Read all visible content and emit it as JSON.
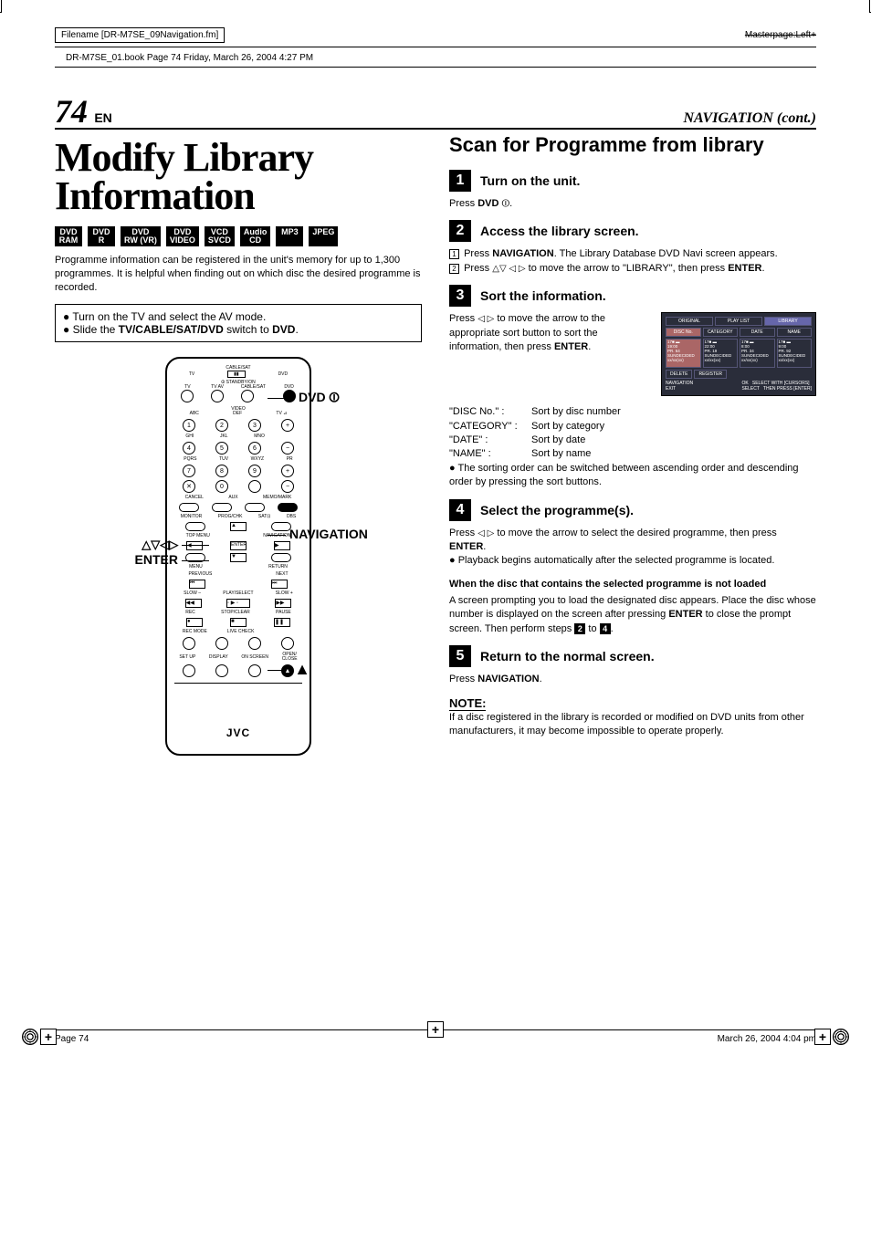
{
  "header": {
    "filename": "Filename [DR-M7SE_09Navigation.fm]",
    "masterpage": "Masterpage:Left+",
    "book_line": "DR-M7SE_01.book  Page 74  Friday, March 26, 2004  4:27 PM"
  },
  "page_header": {
    "page_number": "74",
    "lang": "EN",
    "section": "NAVIGATION (cont.)"
  },
  "left": {
    "title": "Modify Library Information",
    "badges": [
      {
        "l1": "DVD",
        "l2": "RAM"
      },
      {
        "l1": "DVD",
        "l2": "R"
      },
      {
        "l1": "DVD",
        "l2": "RW (VR)"
      },
      {
        "l1": "DVD",
        "l2": "VIDEO"
      },
      {
        "l1": "VCD",
        "l2": "SVCD"
      },
      {
        "l1": "Audio",
        "l2": "CD"
      },
      {
        "l1": "MP3",
        "l2": ""
      },
      {
        "l1": "JPEG",
        "l2": ""
      }
    ],
    "intro": "Programme information can be registered in the unit's memory for up to 1,300 programmes. It is helpful when finding out on which disc the desired programme is recorded.",
    "prep": [
      "Turn on the TV and select the AV mode.",
      "Slide the TV/CABLE/SAT/DVD switch to DVD."
    ],
    "prep_bold": [
      "TV/CABLE/SAT/DVD",
      "DVD"
    ],
    "remote_labels": {
      "dvd_power": "DVD ⏼",
      "navigation": "NAVIGATION",
      "cursors": "△▽◁▷",
      "enter": "ENTER",
      "eject": "▲"
    },
    "remote_text": {
      "cable_sat": "CABLE/SAT",
      "tv": "TV",
      "dvd": "DVD",
      "standby": "⏼ STANDBY/ON",
      "tvmute": "TV",
      "tvav": "TV AV",
      "cablesat": "CABLE/SAT",
      "dvd2": "DVD",
      "video": "VIDEO",
      "abc": "ABC",
      "def": "DEF",
      "tvvol": "TV ⊿",
      "ghi": "GHI",
      "jkl": "JKL",
      "mno": "MNO",
      "pqrs": "PQRS",
      "tuv": "TUV",
      "wxyz": "WXYZ",
      "pr": "PR",
      "cancel": "CANCEL",
      "aux": "AUX",
      "memomark": "MEMO/MARK",
      "monitor": "MONITOR",
      "progchk": "PROG/CHK",
      "satc": "SAT⊡",
      "dbs": "DBS",
      "topmenu": "TOP MENU",
      "navigation": "NAVIGATION",
      "menu": "MENU",
      "enter": "ENTER",
      "return": "RETURN",
      "previous": "PREVIOUS",
      "next": "NEXT",
      "slowm": "SLOW –",
      "playselect": "PLAY/SELECT",
      "slowp": "SLOW +",
      "rec": "REC",
      "stopclear": "STOP/CLEAR",
      "pause": "PAUSE",
      "recmode": "REC MODE",
      "livecheck": "LIVE CHECK",
      "setup": "SET UP",
      "display": "DISPLAY",
      "onscreen": "ON SCREEN",
      "open": "OPEN/\nCLOSE",
      "jvc": "JVC"
    }
  },
  "right": {
    "title": "Scan for Programme from library",
    "steps": [
      {
        "n": "1",
        "title": "Turn on the unit.",
        "body_pre": "Press ",
        "body_bold": "DVD",
        "body_post": " ⏼."
      },
      {
        "n": "2",
        "title": "Access the library screen.",
        "line1": {
          "num": "1",
          "pre": "Press ",
          "b": "NAVIGATION",
          "post": ". The Library Database DVD Navi screen appears."
        },
        "line2": {
          "num": "2",
          "pre": "Press ",
          "arrows": "△▽ ◁ ▷",
          "mid": " to move the arrow to \"LIBRARY\", then press ",
          "b": "ENTER",
          "post": "."
        }
      },
      {
        "n": "3",
        "title": "Sort the information.",
        "body": {
          "pre": "Press ",
          "arrows": "◁ ▷",
          "mid": " to move the arrow to the appropriate sort button to sort the information, then press ",
          "b": "ENTER",
          "post": "."
        },
        "screen": {
          "tabs": [
            "ORIGINAL",
            "PLAY LIST",
            "LIBRARY"
          ],
          "sort_cols": [
            "DISC No.",
            "CATEGORY",
            "DATE",
            "NAME"
          ],
          "cells": [
            {
              "t": "17■ ▬\n19:00\nPR. 64\nSUNDECIDED\nxx/xx(xx)"
            },
            {
              "t": "17■ ▬\n22:00\nPR. 19\nSUNDECIDED\nxx/xx(xx)"
            },
            {
              "t": "17■ ▬\n8:00\nPR. 34\nSUNDECIDED\nxx/xx(xx)"
            },
            {
              "t": "17■ ▬\n9:00\nPR. 92\nSUNDECIDED\nxx/xx(xx)"
            }
          ],
          "bottom": [
            "DELETE",
            "REGISTER"
          ],
          "nav": {
            "l": "NAVIGATION\nEXIT",
            "r": "OK   SELECT WITH [CURSORS]\nSELECT   THEN PRESS [ENTER]"
          }
        },
        "sort_defs": [
          {
            "k": "\"DISC No.\" :",
            "v": "Sort by disc number"
          },
          {
            "k": "\"CATEGORY\" :",
            "v": "Sort by category"
          },
          {
            "k": "\"DATE\" :",
            "v": "Sort by date"
          },
          {
            "k": "\"NAME\" :",
            "v": "Sort by name"
          }
        ],
        "bullet": "The sorting order can be switched between ascending order and descending order by pressing the sort buttons."
      },
      {
        "n": "4",
        "title": "Select the programme(s).",
        "body": {
          "pre": "Press ",
          "arrows": "◁ ▷",
          "mid": " to move the arrow to select the desired programme, then press ",
          "b": "ENTER",
          "post": "."
        },
        "bullet": "Playback begins automatically after the selected programme is located.",
        "when_hd": "When the disc that contains the selected programme is not loaded",
        "when_body_pre": "A screen prompting you to load the designated disc appears. Place the disc whose number is displayed on the screen after pressing ",
        "when_body_b": "ENTER",
        "when_body_mid": " to close the prompt screen. Then perform steps ",
        "when_step_a": "2",
        "when_to": " to ",
        "when_step_b": "4",
        "when_body_post": "."
      },
      {
        "n": "5",
        "title": "Return to the normal screen.",
        "body_pre": "Press ",
        "body_b": "NAVIGATION",
        "body_post": "."
      }
    ],
    "note_hd": "NOTE:",
    "note_body": "If a disc registered in the library is recorded or modified on DVD units from other manufacturers, it may become impossible to operate properly."
  },
  "footer": {
    "left": "Page 74",
    "right": "March 26, 2004  4:04 pm"
  }
}
